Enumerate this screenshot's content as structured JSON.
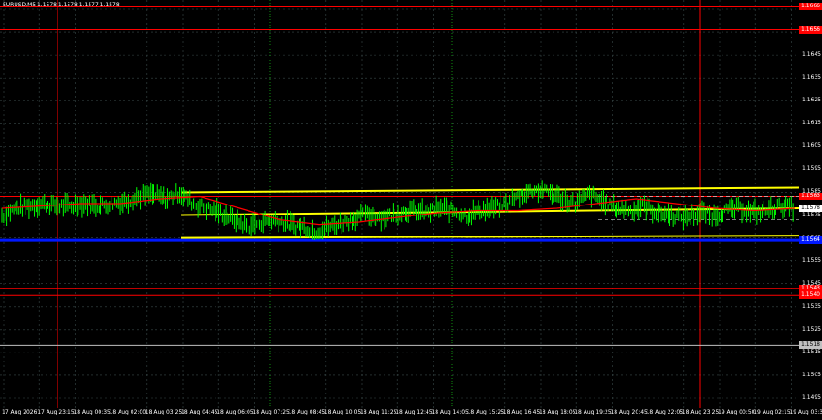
{
  "header": {
    "symbol_text": "EURUSD,M5  1.1578 1.1578 1.1577 1.1578"
  },
  "price_axis": {
    "labels": [
      "1.1665",
      "1.1655",
      "1.1645",
      "1.1635",
      "1.1625",
      "1.1615",
      "1.1605",
      "1.1595",
      "1.1585",
      "1.1575",
      "1.1565",
      "1.1555",
      "1.1545",
      "1.1535",
      "1.1525",
      "1.1515",
      "1.1505",
      "1.1495"
    ],
    "badges": [
      {
        "text": "1.1666",
        "color": "#ff0000"
      },
      {
        "text": "1.1656",
        "color": "#ff0000"
      },
      {
        "text": "1.1583",
        "color": "#ff0000"
      },
      {
        "text": "1.1578",
        "color": "#ffffff",
        "text_color": "#000000"
      },
      {
        "text": "1.1564",
        "color": "#0018ff"
      },
      {
        "text": "1.1543",
        "color": "#ff0000"
      },
      {
        "text": "1.1540",
        "color": "#ff0000"
      },
      {
        "text": "1.1518",
        "color": "#c0c0c0",
        "text_color": "#000000"
      }
    ]
  },
  "time_axis": {
    "labels": [
      "17 Aug 2026",
      "17 Aug 23:15",
      "18 Aug 00:35",
      "18 Aug 02:00",
      "18 Aug 03:25",
      "18 Aug 04:45",
      "18 Aug 06:05",
      "18 Aug 07:25",
      "18 Aug 08:45",
      "18 Aug 10:05",
      "18 Aug 11:25",
      "18 Aug 12:45",
      "18 Aug 14:05",
      "18 Aug 15:25",
      "18 Aug 16:45",
      "18 Aug 18:05",
      "18 Aug 19:25",
      "18 Aug 20:45",
      "18 Aug 22:05",
      "18 Aug 23:25",
      "19 Aug 00:50",
      "19 Aug 02:15",
      "19 Aug 03:35"
    ]
  },
  "chart_data": {
    "type": "line",
    "title": "EURUSD,M5",
    "ylim": [
      1.149,
      1.167
    ],
    "levels": [
      {
        "price": 1.1666,
        "color": "#ff0000"
      },
      {
        "price": 1.1656,
        "color": "#ff0000"
      },
      {
        "price": 1.1583,
        "color": "#ff0000"
      },
      {
        "price": 1.1564,
        "color": "#0018ff"
      },
      {
        "price": 1.1543,
        "color": "#ff0000"
      },
      {
        "price": 1.154,
        "color": "#ff0000"
      },
      {
        "price": 1.1518,
        "color": "#c0c0c0"
      }
    ],
    "channel_upper": [
      [
        1.1585,
        1.1587
      ]
    ],
    "channel_middle": [
      [
        1.1575,
        1.1578
      ]
    ],
    "channel_lower": [
      [
        1.1565,
        1.1566
      ]
    ],
    "price_series": [
      1.1575,
      1.1578,
      1.1579,
      1.158,
      1.1579,
      1.1579,
      1.158,
      1.1579,
      1.158,
      1.1581,
      1.1583,
      1.1584,
      1.1582,
      1.1585,
      1.158,
      1.1578,
      1.1576,
      1.1573,
      1.157,
      1.1572,
      1.1573,
      1.1571,
      1.157,
      1.1568,
      1.157,
      1.1572,
      1.1574,
      1.1575,
      1.1574,
      1.1576,
      1.1577,
      1.1576,
      1.1578,
      1.1577,
      1.1575,
      1.1577,
      1.1578,
      1.158,
      1.1584,
      1.1586,
      1.1585,
      1.1582,
      1.158,
      1.1584,
      1.1581,
      1.1578,
      1.1577,
      1.1579,
      1.1576,
      1.1575,
      1.1574,
      1.1576,
      1.1575,
      1.1577,
      1.1578,
      1.1576,
      1.1577,
      1.1579,
      1.1578
    ],
    "moving_average": [
      1.1578,
      1.1579,
      1.158,
      1.158,
      1.1582,
      1.1583,
      1.1578,
      1.1573,
      1.1571,
      1.1572,
      1.1574,
      1.1576,
      1.1577,
      1.1577,
      1.1578,
      1.158,
      1.1582,
      1.158,
      1.1578,
      1.1577,
      1.1578
    ],
    "colors": {
      "candles": "#00ff00",
      "ma": "#ff0000",
      "channel": "#ffff00",
      "grid": "#3a4a4a",
      "session": "#ff0000",
      "session_green": "#0f8f0f"
    }
  }
}
